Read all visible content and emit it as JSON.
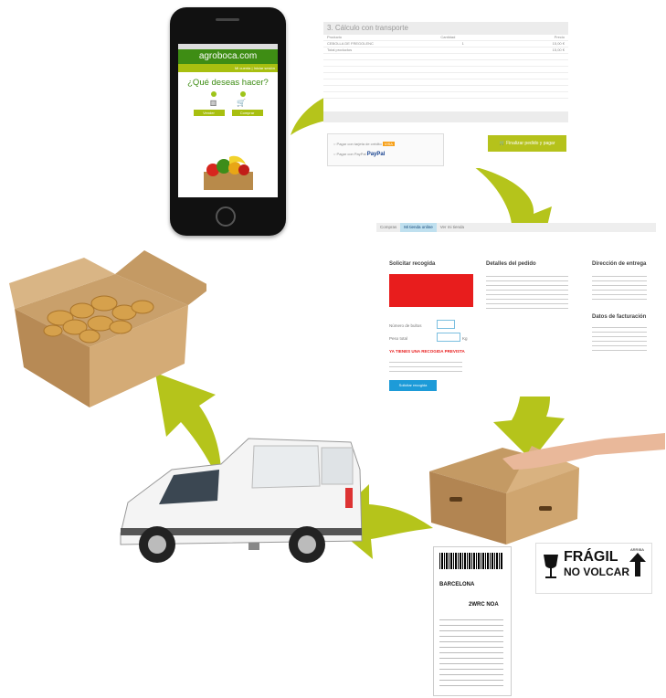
{
  "phone": {
    "brand": "agroboca.com",
    "menu_links": "Mi cuenta | Iniciar sesión",
    "question": "¿Qué deseas hacer?",
    "buttons": [
      "Vender",
      "Comprar"
    ]
  },
  "checkout": {
    "heading": "3. Cálculo con transporte",
    "columns": [
      "Producto",
      "Cantidad",
      "Precio"
    ],
    "product": "CEBOLLA DE FREGOLENC",
    "quantity": "1",
    "price": "15,00 €",
    "total_products_label": "Total productos",
    "total_products": "15,00 €",
    "pay_card": "Pagar con tarjeta de crédito",
    "pay_paypal": "Pagar con PayPal",
    "paypal_logo": "PayPal",
    "pay_button": "Finalizar pedido y pagar"
  },
  "pickup": {
    "tabs": [
      "Compras",
      "Mi tienda online",
      "Ver mi tienda"
    ],
    "solicitar": "Solicitar recogida",
    "detalles": "Detalles del pedido",
    "direccion": "Dirección de entrega",
    "facturacion": "Datos de facturación",
    "bultos_label": "Número de bultos",
    "peso_label": "Peso total",
    "peso_unit": "Kg",
    "warning": "YA TIENES UNA RECOGIDA PREVISTA",
    "submit": "Solicitar recogida"
  },
  "shipping_label": {
    "city": "BARCELONA",
    "code": "2WRC NOA"
  },
  "fragile": {
    "line1": "FRÁGIL",
    "line2": "NO VOLCAR",
    "arriba": "ARRIBA"
  },
  "colors": {
    "arrow": "#b5c41b",
    "brand_green": "#3e8d14",
    "alert_red": "#e81d1d",
    "action_blue": "#1d9bd8"
  }
}
